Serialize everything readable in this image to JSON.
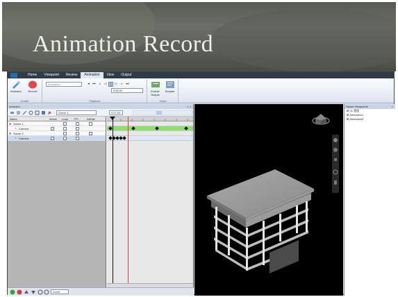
{
  "slide": {
    "title": "Animation Record"
  },
  "app": {
    "ribbon_tabs": [
      "Home",
      "Viewpoint",
      "Review",
      "Animation",
      "View",
      "Output"
    ],
    "active_tab": "Animation",
    "groups": {
      "create": {
        "label": "Create",
        "animator": "Animator",
        "record": "Record"
      },
      "playback": {
        "label": "Playback",
        "animation_combo": "Animation",
        "time": "0:00.00"
      },
      "script": {
        "label": "Script",
        "enable": "Enable Scripts",
        "scripter": "Scripter"
      }
    }
  },
  "animator": {
    "title": "Animator",
    "scene_combo": "Scene 1",
    "time": "0:07.53",
    "columns": [
      "Name",
      "Active",
      "Loop",
      "P.P.",
      "Infinite"
    ],
    "rows": [
      {
        "name": "Scene 1",
        "indent": 0
      },
      {
        "name": "Camera",
        "indent": 1
      },
      {
        "name": "Scene 2",
        "indent": 0
      },
      {
        "name": "Camera",
        "indent": 1
      }
    ],
    "zoom": "Zoom"
  },
  "saved_viewpoints": {
    "title": "Saved Viewpoints",
    "items": [
      "01 里程",
      "Animation1",
      "Animation2"
    ]
  },
  "colors": {
    "track_green": "#8ee06a",
    "playhead_red": "#e23b3b",
    "record_red": "#e0484e",
    "ribbon_bar": "#2f3a4a"
  }
}
